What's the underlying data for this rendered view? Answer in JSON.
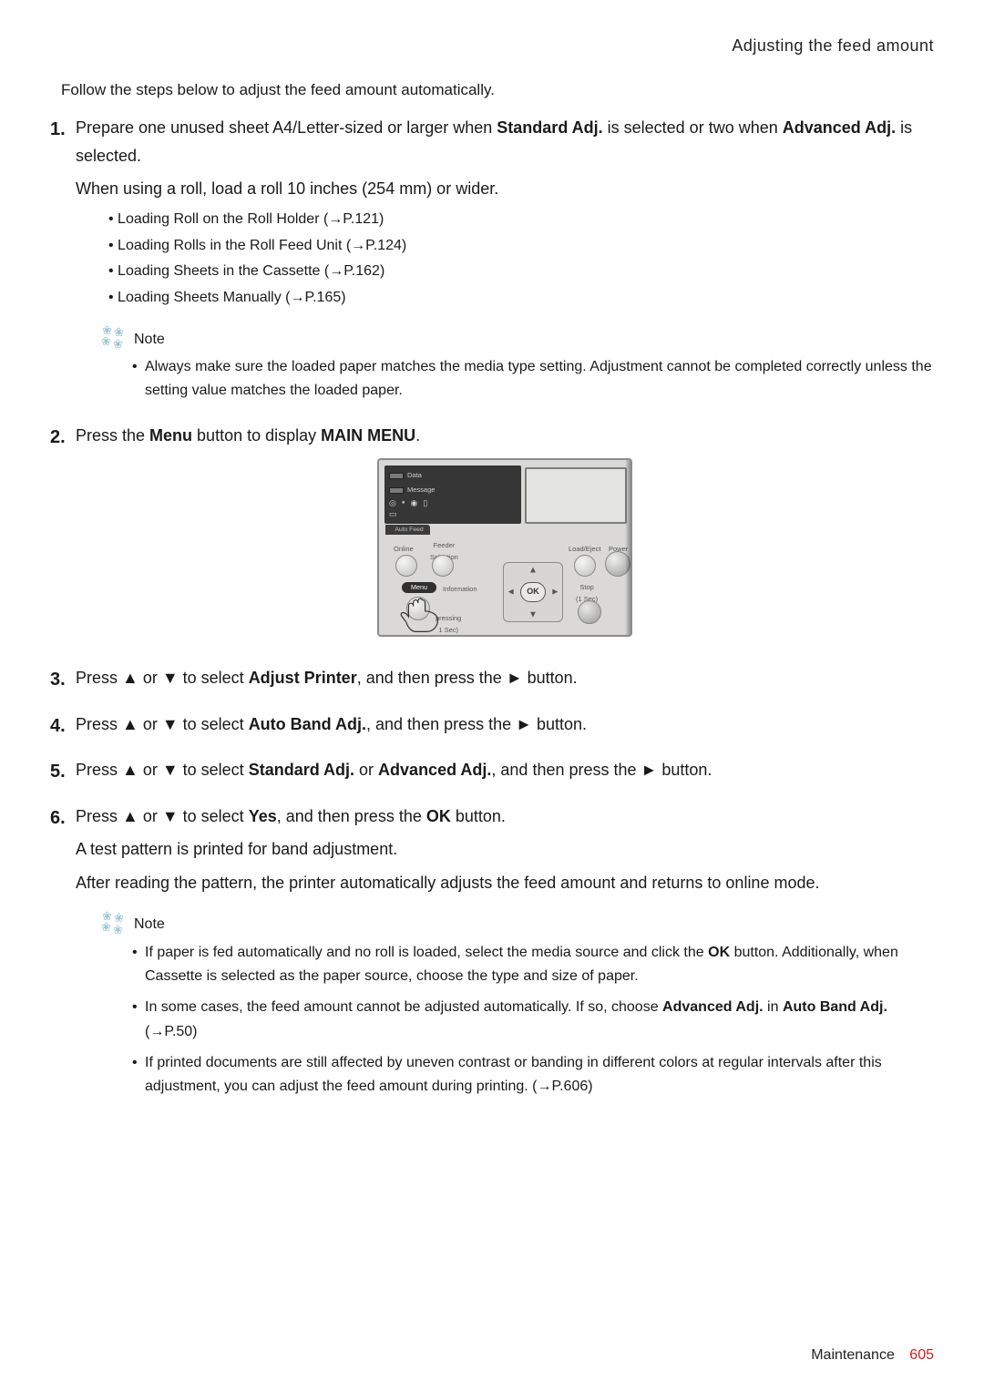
{
  "header": {
    "title": "Adjusting the feed amount"
  },
  "intro": "Follow the steps below to adjust the feed amount automatically.",
  "steps": {
    "s1": {
      "line1_a": "Prepare one unused sheet A4/Letter-sized or larger when ",
      "line1_b": "Standard Adj.",
      "line1_c": " is selected or two when ",
      "line1_d": "Advanced Adj.",
      "line1_e": " is selected.",
      "line2": "When using a roll, load a roll 10 inches (254 mm) or wider.",
      "bullets": [
        "Loading Roll on the Roll Holder (→P.121)",
        "Loading Rolls in the Roll Feed Unit (→P.124)",
        "Loading Sheets in the Cassette (→P.162)",
        "Loading Sheets Manually (→P.165)"
      ],
      "note_label": "Note",
      "note_items": [
        "Always make sure the loaded paper matches the media type setting. Adjustment cannot be completed correctly unless the setting value matches the loaded paper."
      ]
    },
    "s2": {
      "t1": "Press the ",
      "t2": "Menu",
      "t3": " button to display ",
      "t4": "MAIN MENU",
      "t5": "."
    },
    "s3": {
      "t1": "Press ▲ or ▼ to select ",
      "t2": "Adjust Printer",
      "t3": ", and then press the ► button."
    },
    "s4": {
      "t1": "Press ▲ or ▼ to select ",
      "t2": "Auto Band Adj.",
      "t3": ", and then press the ► button."
    },
    "s5": {
      "t1": "Press ▲ or ▼ to select ",
      "t2": "Standard Adj.",
      "t3": " or ",
      "t4": "Advanced Adj.",
      "t5": ", and then press the ► button."
    },
    "s6": {
      "t1": "Press ▲ or ▼ to select ",
      "t2": "Yes",
      "t3": ", and then press the ",
      "t4": "OK",
      "t5": " button.",
      "l2": "A test pattern is printed for band adjustment.",
      "l3": "After reading the pattern, the printer automatically adjusts the feed amount and returns to online mode.",
      "note_label": "Note",
      "note_items": {
        "n1a": "If paper is fed automatically and no roll is loaded, select the media source and click the ",
        "n1b": "OK",
        "n1c": " button. Additionally, when Cassette is selected as the paper source, choose the type and size of paper.",
        "n2a": "In some cases, the feed amount cannot be adjusted automatically. If so, choose ",
        "n2b": "Advanced Adj.",
        "n2c": " in ",
        "n2d": "Auto Band Adj.",
        "n2e": " (→P.50)",
        "n3": "If printed documents are still affected by uneven contrast or banding in different colors at regular intervals after this adjustment, you can adjust the feed amount during printing. (→P.606)"
      }
    }
  },
  "figure": {
    "data": "Data",
    "message": "Message",
    "autofeed": "Auto Feed",
    "online": "Online",
    "feeder": "Feeder\nSelection",
    "load": "Load/Eject",
    "power": "Power",
    "menu": "Menu",
    "info": "Information",
    "stop": "Stop\n(1 Sec)",
    "pressing": "pressing\n1 Sec)",
    "ok": "OK"
  },
  "footer": {
    "label": "Maintenance",
    "page": "605"
  }
}
